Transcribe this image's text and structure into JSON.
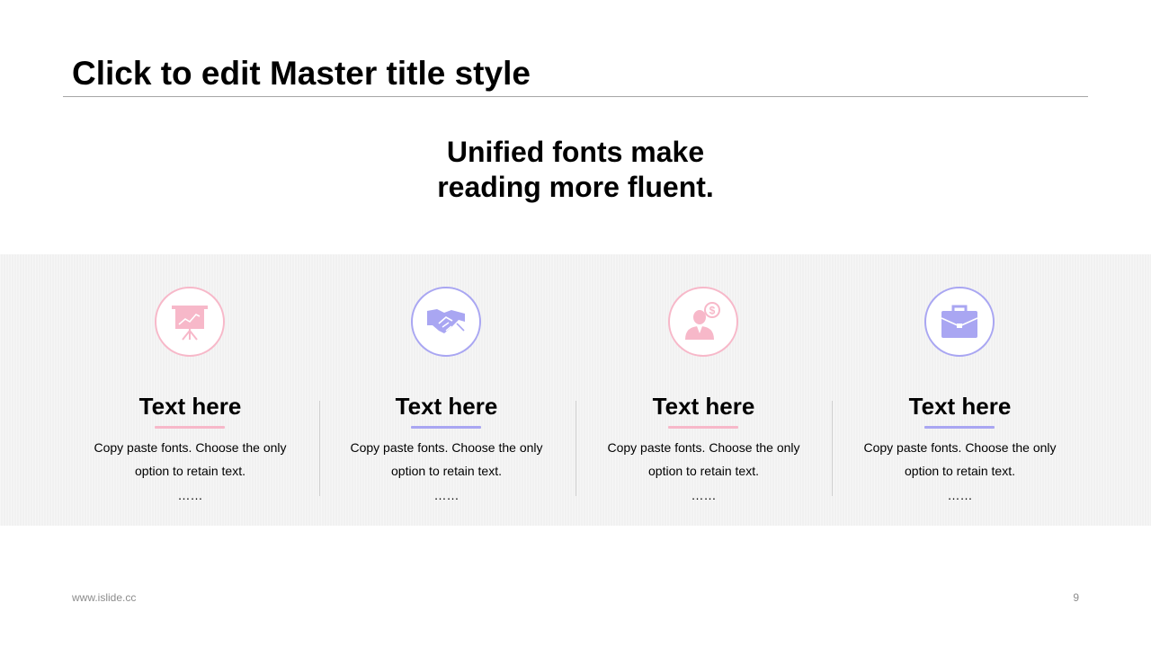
{
  "slide": {
    "title": "Click to edit Master title style",
    "subtitle_line1": "Unified fonts make",
    "subtitle_line2": "reading more fluent."
  },
  "colors": {
    "pink": "#f7b8c9",
    "lavender": "#a9a6f2"
  },
  "cards": [
    {
      "icon": "presentation-board-icon",
      "accent": "pink",
      "heading": "Text here",
      "body": "Copy paste fonts. Choose the only option to retain text.",
      "ellipsis": "……"
    },
    {
      "icon": "handshake-icon",
      "accent": "lavender",
      "heading": "Text here",
      "body": "Copy paste fonts. Choose the only option to retain text.",
      "ellipsis": "……"
    },
    {
      "icon": "person-money-icon",
      "accent": "pink",
      "heading": "Text here",
      "body": "Copy paste fonts. Choose the only option to retain text.",
      "ellipsis": "……"
    },
    {
      "icon": "briefcase-icon",
      "accent": "lavender",
      "heading": "Text here",
      "body": "Copy paste fonts. Choose the only option to retain text.",
      "ellipsis": "……"
    }
  ],
  "footer": {
    "url": "www.islide.cc",
    "page_number": "9"
  }
}
